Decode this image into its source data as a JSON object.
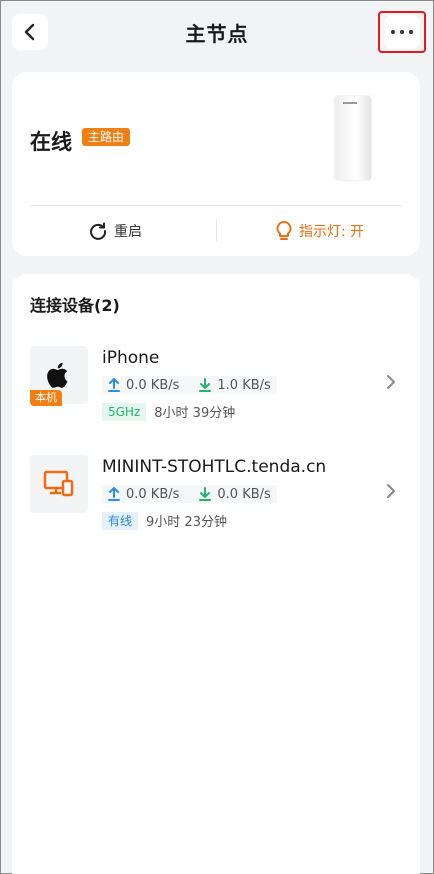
{
  "header": {
    "title": "主节点",
    "back_icon": "chevron-left-icon",
    "more_icon": "more-dots-icon"
  },
  "status": {
    "state": "在线",
    "role_badge": "主路由",
    "restart_label": "重启",
    "indicator_label": "指示灯: 开"
  },
  "devices": {
    "title": "连接设备(2)",
    "items": [
      {
        "icon": "apple-icon",
        "local_tag": "本机",
        "name": "iPhone",
        "upload": "0.0 KB/s",
        "download": "1.0 KB/s",
        "band": "5GHz",
        "duration": "8小时 39分钟"
      },
      {
        "icon": "computer-icon",
        "name": "MININT-STOHTLC.tenda.cn",
        "upload": "0.0 KB/s",
        "download": "0.0 KB/s",
        "band": "有线",
        "duration": "9小时 23分钟"
      }
    ]
  },
  "colors": {
    "accent_orange": "#f27f14",
    "upload_blue": "#2b8fe0",
    "download_green": "#24b36b",
    "highlight_red": "#e01b1b"
  }
}
